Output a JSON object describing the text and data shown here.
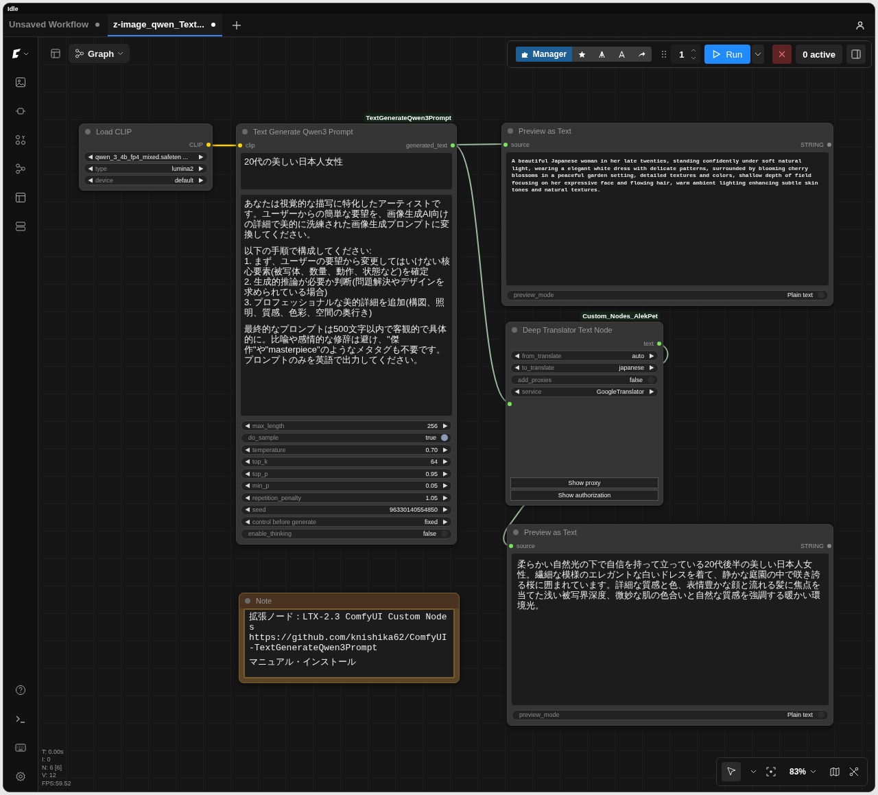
{
  "title_bar": {
    "status": "Idle"
  },
  "tabs": [
    {
      "label": "Unsaved Workflow",
      "selected": false,
      "modified": true
    },
    {
      "label": "z-image_qwen_Text...",
      "selected": true,
      "modified": true
    }
  ],
  "toolbar": {
    "view_mode": "Graph",
    "manager": "Manager",
    "queue_count": "1",
    "run": "Run",
    "active": "0 active"
  },
  "nodes": [
    {
      "kind": "node",
      "title": "Load CLIP",
      "outputs": [
        {
          "name": "CLIP",
          "color": "#ffd500"
        }
      ],
      "widgets": [
        {
          "kind": "combo",
          "value": "qwen_3_4b_fp4_mixed.safeten ..."
        },
        {
          "kind": "combo",
          "label": "type",
          "value": "lumina2"
        },
        {
          "kind": "combo",
          "label": "device",
          "value": "default"
        }
      ]
    },
    {
      "kind": "node",
      "title": "Text Generate Qwen3 Prompt",
      "badge": "TextGenerateQwen3Prompt",
      "inputs": [
        {
          "name": "clip",
          "color": "#ffd500"
        }
      ],
      "outputs": [
        {
          "name": "generated_text",
          "color": "#7ae35c"
        }
      ],
      "texts": [
        {
          "kind": "prompt",
          "paragraphs": [
            [
              "20代の美しい日本人女性"
            ]
          ]
        },
        {
          "kind": "prompt",
          "paragraphs": [
            [
              "あなたは視覚的な描写に特化したアーティストです。ユーザーからの簡単な要望を、画像生成AI向けの詳細で美的に洗練された画像生成プロンプトに変換してください。"
            ],
            [
              "以下の手順で構成してください:",
              "1. まず、ユーザーの要望から変更してはいけない核心要素(被写体、数量、動作、状態など)を確定",
              "2. 生成的推論が必要か判断(問題解決やデザインを求められている場合)",
              "3. プロフェッショナルな美的詳細を追加(構図、照明、質感、色彩、空間の奥行き)"
            ],
            [
              "最終的なプロンプトは500文字以内で客観的で具体的に。比喩や感情的な修辞は避け、\"傑作\"や\"masterpiece\"のようなメタタグも不要です。プロンプトのみを英語で出力してください。"
            ]
          ]
        }
      ],
      "widgets": [
        {
          "kind": "number",
          "label": "max_length",
          "value": "256"
        },
        {
          "kind": "toggle",
          "label": "do_sample",
          "value": "true",
          "on": true
        },
        {
          "kind": "number",
          "label": "temperature",
          "value": "0.70"
        },
        {
          "kind": "number",
          "label": "top_k",
          "value": "64"
        },
        {
          "kind": "number",
          "label": "top_p",
          "value": "0.95"
        },
        {
          "kind": "number",
          "label": "min_p",
          "value": "0.05"
        },
        {
          "kind": "number",
          "label": "repetition_penalty",
          "value": "1.05"
        },
        {
          "kind": "number",
          "label": "seed",
          "value": "96330140554850"
        },
        {
          "kind": "combo",
          "label": "control before generate",
          "value": "fixed"
        },
        {
          "kind": "toggle",
          "label": "enable_thinking",
          "value": "false",
          "on": false
        }
      ]
    },
    {
      "kind": "node",
      "title": "Preview as Text",
      "inputs": [
        {
          "name": "source",
          "color": "#7ae35c"
        }
      ],
      "outputs": [
        {
          "name": "STRING",
          "color": "#8a8a8a"
        }
      ],
      "texts": [
        {
          "kind": "preview",
          "paragraphs": [
            [
              "A beautiful Japanese woman in her late twenties, standing confidently under soft natural light, wearing a elegant white dress with delicate patterns, surrounded by blooming cherry blossoms in a peaceful garden setting, detailed textures and colors, shallow depth of field focusing on her expressive face and flowing hair, warm ambient lighting enhancing subtle skin tones and natural textures."
            ]
          ]
        }
      ],
      "widgets": [
        {
          "kind": "toggle",
          "label": "preview_mode",
          "value": "Plain text",
          "on": false
        }
      ]
    },
    {
      "kind": "node",
      "title": "Deep Translator Text Node",
      "badge": "Custom_Nodes_AlekPet",
      "inputs": [
        {
          "color": "#7ae35c"
        }
      ],
      "outputs": [
        {
          "name": "text",
          "color": "#7ae35c"
        }
      ],
      "widgets": [
        {
          "kind": "combo",
          "label": "from_translate",
          "value": "auto"
        },
        {
          "kind": "combo",
          "label": "to_translate",
          "value": "japanese"
        },
        {
          "kind": "toggle",
          "label": "add_proxies",
          "value": "false",
          "on": false
        },
        {
          "kind": "combo",
          "label": "service",
          "value": "GoogleTranslator"
        }
      ],
      "buttons": [
        "Show proxy",
        "Show authorization"
      ]
    },
    {
      "kind": "note",
      "title": "Note",
      "texts": [
        {
          "kind": "preview",
          "paragraphs": [
            [
              "拡張ノード：LTX-2.3 ComfyUI Custom Nodes",
              "https://github.com/knishika62/ComfyUI-TextGenerateQwen3Prompt"
            ],
            [
              "マニュアル・インストール"
            ]
          ]
        }
      ]
    },
    {
      "kind": "node",
      "title": "Preview as Text",
      "inputs": [
        {
          "name": "source",
          "color": "#7ae35c"
        }
      ],
      "outputs": [
        {
          "name": "STRING",
          "color": "#8a8a8a"
        }
      ],
      "texts": [
        {
          "kind": "preview",
          "paragraphs": [
            [
              "柔らかい自然光の下で自信を持って立っている20代後半の美しい日本人女性。繊細な模様のエレガントな白いドレスを着て、静かな庭園の中で咲き誇る桜に囲まれています。詳細な質感と色、表情豊かな顔と流れる髪に焦点を当てた浅い被写界深度、微妙な肌の色合いと自然な質感を強調する暖かい環境光。"
            ]
          ]
        }
      ],
      "widgets": [
        {
          "kind": "toggle",
          "label": "preview_mode",
          "value": "Plain text",
          "on": false
        }
      ]
    }
  ],
  "stats": [
    "T: 0.00s",
    "I: 0",
    "N: 6 [6]",
    "V: 12",
    "FPS:59.52"
  ],
  "zoom": "83%"
}
